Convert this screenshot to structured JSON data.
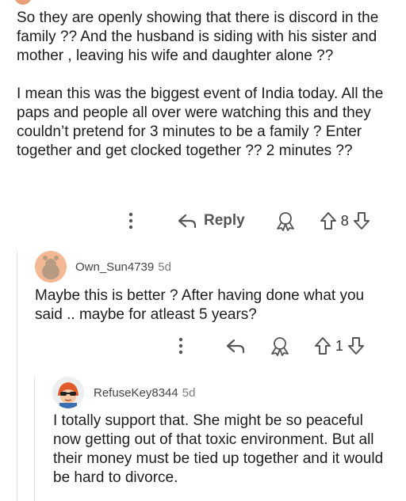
{
  "comment1": {
    "paragraphs": [
      "So they are openly showing that there is discord in the family ?? And the husband is siding  with his sister and mother , leaving his wife and daughter alone ??",
      "I mean this was the biggest event of India today. All the paps and people all over were watching this and they couldn’t pretend for 3 minutes to be a family ? Enter together and get clocked together ?? 2 minutes ??"
    ],
    "reply_label": "Reply",
    "vote_count": "8"
  },
  "comment2": {
    "username": "Own_Sun4739",
    "age": "5d",
    "text": "Maybe this is better ? After having done what you said .. maybe for atleast 5 years?",
    "vote_count": "1",
    "avatar_color": "#f4b894"
  },
  "comment3": {
    "username": "RefuseKey8344",
    "age": "5d",
    "text": "I totally support that. She might be so peaceful now getting out of that toxic environment. But all their money must be tied up together and it would be hard to divorce."
  },
  "icons": [
    "more-options-icon",
    "reply-arrow-icon",
    "award-icon",
    "upvote-icon",
    "downvote-icon"
  ]
}
